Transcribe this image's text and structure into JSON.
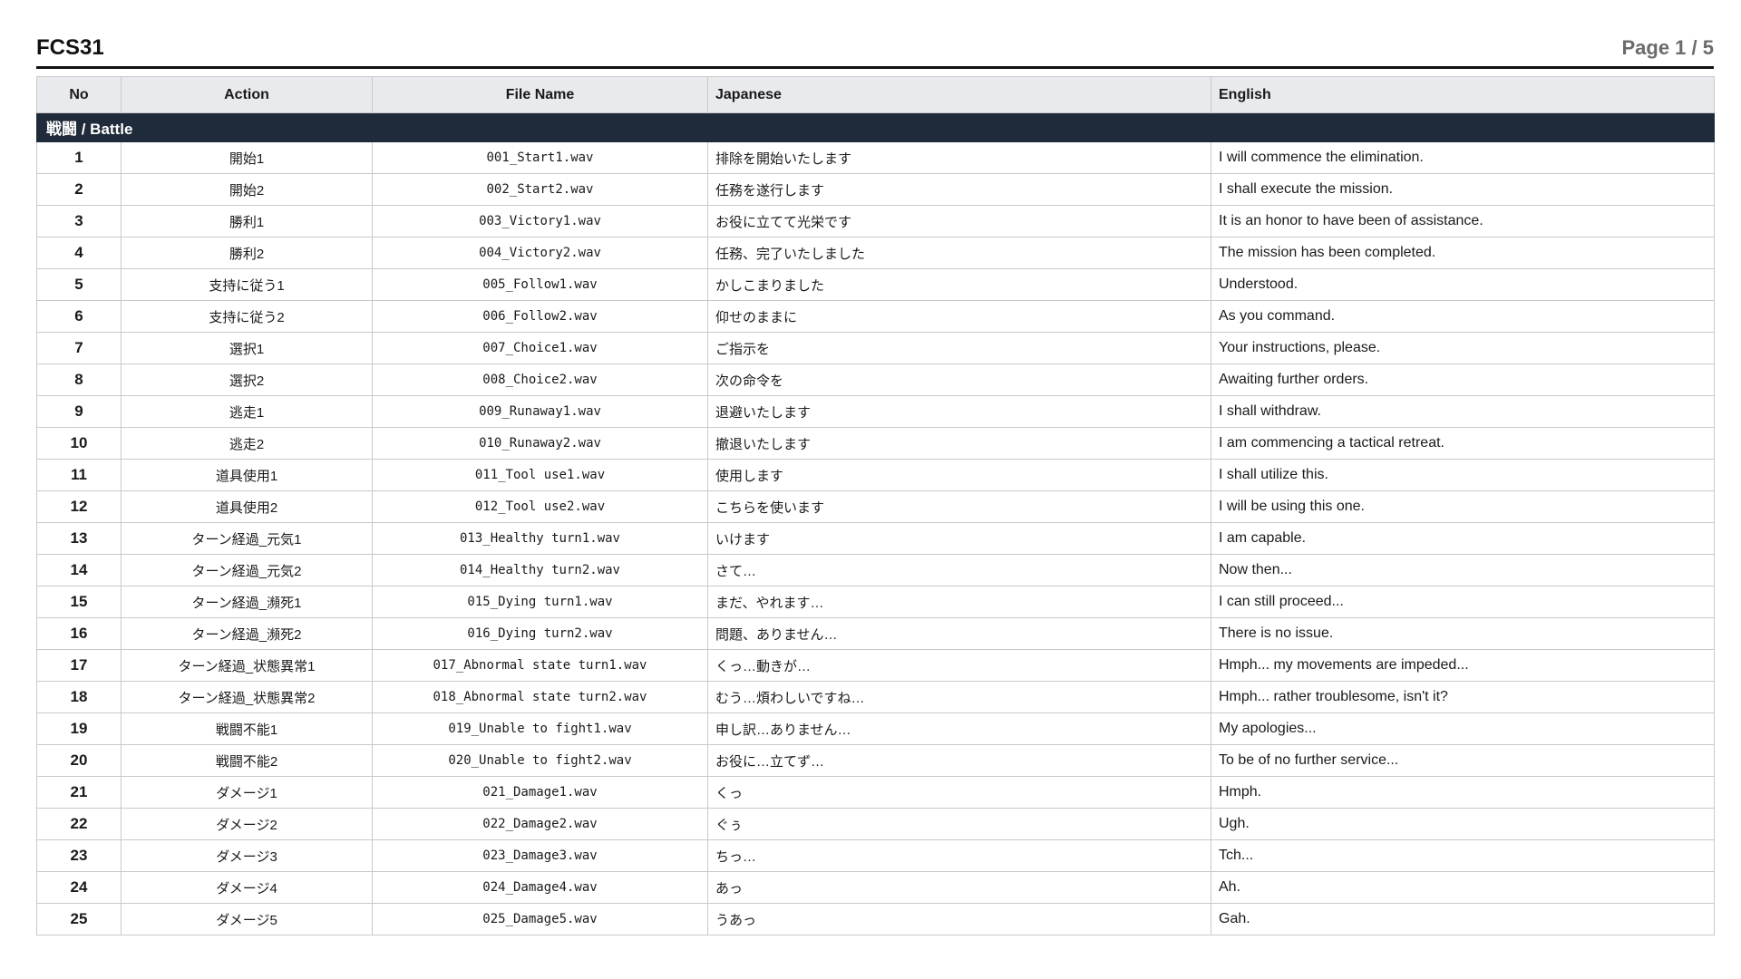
{
  "document": {
    "title": "FCS31",
    "page_indicator": "Page 1 / 5"
  },
  "table": {
    "headers": {
      "no": "No",
      "action": "Action",
      "file_name": "File Name",
      "japanese": "Japanese",
      "english": "English"
    },
    "section_label": "戦闘 / Battle",
    "rows": [
      {
        "no": "1",
        "action": "開始1",
        "file": "001_Start1.wav",
        "ja": "排除を開始いたします",
        "en": "I will commence the elimination."
      },
      {
        "no": "2",
        "action": "開始2",
        "file": "002_Start2.wav",
        "ja": "任務を遂行します",
        "en": "I shall execute the mission."
      },
      {
        "no": "3",
        "action": "勝利1",
        "file": "003_Victory1.wav",
        "ja": "お役に立てて光栄です",
        "en": "It is an honor to have been of assistance."
      },
      {
        "no": "4",
        "action": "勝利2",
        "file": "004_Victory2.wav",
        "ja": "任務、完了いたしました",
        "en": "The mission has been completed."
      },
      {
        "no": "5",
        "action": "支持に従う1",
        "file": "005_Follow1.wav",
        "ja": "かしこまりました",
        "en": "Understood."
      },
      {
        "no": "6",
        "action": "支持に従う2",
        "file": "006_Follow2.wav",
        "ja": "仰せのままに",
        "en": "As you command."
      },
      {
        "no": "7",
        "action": "選択1",
        "file": "007_Choice1.wav",
        "ja": "ご指示を",
        "en": "Your instructions, please."
      },
      {
        "no": "8",
        "action": "選択2",
        "file": "008_Choice2.wav",
        "ja": "次の命令を",
        "en": "Awaiting further orders."
      },
      {
        "no": "9",
        "action": "逃走1",
        "file": "009_Runaway1.wav",
        "ja": "退避いたします",
        "en": "I shall withdraw."
      },
      {
        "no": "10",
        "action": "逃走2",
        "file": "010_Runaway2.wav",
        "ja": "撤退いたします",
        "en": "I am commencing a tactical retreat."
      },
      {
        "no": "11",
        "action": "道具使用1",
        "file": "011_Tool use1.wav",
        "ja": "使用します",
        "en": "I shall utilize this."
      },
      {
        "no": "12",
        "action": "道具使用2",
        "file": "012_Tool use2.wav",
        "ja": "こちらを使います",
        "en": "I will be using this one."
      },
      {
        "no": "13",
        "action": "ターン経過_元気1",
        "file": "013_Healthy turn1.wav",
        "ja": "いけます",
        "en": "I am capable."
      },
      {
        "no": "14",
        "action": "ターン経過_元気2",
        "file": "014_Healthy turn2.wav",
        "ja": "さて…",
        "en": "Now then..."
      },
      {
        "no": "15",
        "action": "ターン経過_瀕死1",
        "file": "015_Dying turn1.wav",
        "ja": "まだ、やれます…",
        "en": "I can still proceed..."
      },
      {
        "no": "16",
        "action": "ターン経過_瀕死2",
        "file": "016_Dying turn2.wav",
        "ja": "問題、ありません…",
        "en": "There is no issue."
      },
      {
        "no": "17",
        "action": "ターン経過_状態異常1",
        "file": "017_Abnormal state turn1.wav",
        "ja": "くっ…動きが…",
        "en": "Hmph... my movements are impeded..."
      },
      {
        "no": "18",
        "action": "ターン経過_状態異常2",
        "file": "018_Abnormal state turn2.wav",
        "ja": "むう…煩わしいですね…",
        "en": "Hmph... rather troublesome, isn't it?"
      },
      {
        "no": "19",
        "action": "戦闘不能1",
        "file": "019_Unable to fight1.wav",
        "ja": "申し訳…ありません…",
        "en": "My apologies..."
      },
      {
        "no": "20",
        "action": "戦闘不能2",
        "file": "020_Unable to fight2.wav",
        "ja": "お役に…立てず…",
        "en": "To be of no further service..."
      },
      {
        "no": "21",
        "action": "ダメージ1",
        "file": "021_Damage1.wav",
        "ja": "くっ",
        "en": "Hmph."
      },
      {
        "no": "22",
        "action": "ダメージ2",
        "file": "022_Damage2.wav",
        "ja": "ぐぅ",
        "en": "Ugh."
      },
      {
        "no": "23",
        "action": "ダメージ3",
        "file": "023_Damage3.wav",
        "ja": "ちっ…",
        "en": "Tch..."
      },
      {
        "no": "24",
        "action": "ダメージ4",
        "file": "024_Damage4.wav",
        "ja": "あっ",
        "en": "Ah."
      },
      {
        "no": "25",
        "action": "ダメージ5",
        "file": "025_Damage5.wav",
        "ja": "うあっ",
        "en": "Gah."
      }
    ]
  }
}
